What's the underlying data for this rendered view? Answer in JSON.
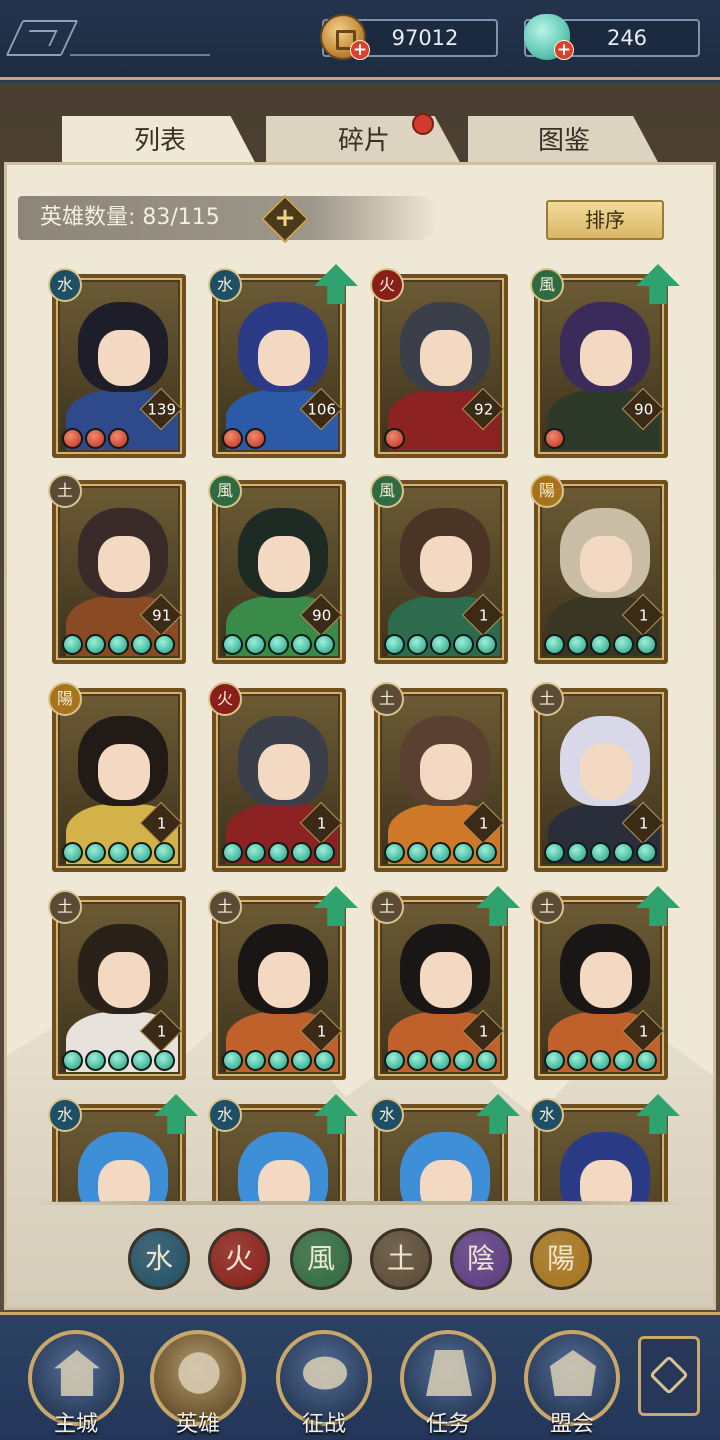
{
  "currency": {
    "coins": "97012",
    "jade": "246"
  },
  "tabs": [
    {
      "label": "列表",
      "active": true
    },
    {
      "label": "碎片",
      "active": false,
      "notification": true
    },
    {
      "label": "图鉴",
      "active": false
    }
  ],
  "hero_count_label": "英雄数量: 83/115",
  "sort_label": "排序",
  "heroes": [
    {
      "element": "水",
      "level": "139",
      "orbs": 3,
      "orb_color": "red",
      "upgrade": false,
      "hair": "#1e1e2a",
      "outfit": "#2e4a8a"
    },
    {
      "element": "水",
      "level": "106",
      "orbs": 2,
      "orb_color": "red",
      "upgrade": true,
      "hair": "#2b3b86",
      "outfit": "#2d5aa6"
    },
    {
      "element": "火",
      "level": "92",
      "orbs": 1,
      "orb_color": "red",
      "upgrade": false,
      "hair": "#3a3f4a",
      "outfit": "#8c2222"
    },
    {
      "element": "風",
      "level": "90",
      "orbs": 1,
      "orb_color": "red",
      "upgrade": true,
      "hair": "#3a2b5a",
      "outfit": "#2d3a2a"
    },
    {
      "element": "土",
      "level": "91",
      "orbs": 5,
      "orb_color": "green",
      "upgrade": false,
      "hair": "#3a2a2a",
      "outfit": "#8a4a24"
    },
    {
      "element": "風",
      "level": "90",
      "orbs": 5,
      "orb_color": "green",
      "upgrade": false,
      "hair": "#1e2a24",
      "outfit": "#3a8a4a"
    },
    {
      "element": "風",
      "level": "1",
      "orbs": 5,
      "orb_color": "green",
      "upgrade": false,
      "hair": "#4a3426",
      "outfit": "#2e6a4e"
    },
    {
      "element": "陽",
      "level": "1",
      "orbs": 5,
      "orb_color": "green",
      "upgrade": false,
      "hair": "#c9bda5",
      "outfit": "#3a3624"
    },
    {
      "element": "陽",
      "level": "1",
      "orbs": 5,
      "orb_color": "green",
      "upgrade": false,
      "hair": "#221a16",
      "outfit": "#d4b24a"
    },
    {
      "element": "火",
      "level": "1",
      "orbs": 5,
      "orb_color": "green",
      "upgrade": false,
      "hair": "#3a3f4a",
      "outfit": "#8c2222"
    },
    {
      "element": "土",
      "level": "1",
      "orbs": 5,
      "orb_color": "green",
      "upgrade": false,
      "hair": "#5a4030",
      "outfit": "#d0782a"
    },
    {
      "element": "土",
      "level": "1",
      "orbs": 5,
      "orb_color": "green",
      "upgrade": false,
      "hair": "#d8d8e8",
      "outfit": "#2a2e3a"
    },
    {
      "element": "土",
      "level": "1",
      "orbs": 5,
      "orb_color": "green",
      "upgrade": false,
      "hair": "#2a2218",
      "outfit": "#e8e2dc"
    },
    {
      "element": "土",
      "level": "1",
      "orbs": 5,
      "orb_color": "green",
      "upgrade": true,
      "hair": "#1a1616",
      "outfit": "#c0602a"
    },
    {
      "element": "土",
      "level": "1",
      "orbs": 5,
      "orb_color": "green",
      "upgrade": true,
      "hair": "#1a1616",
      "outfit": "#c0602a"
    },
    {
      "element": "土",
      "level": "1",
      "orbs": 5,
      "orb_color": "green",
      "upgrade": true,
      "hair": "#1a1616",
      "outfit": "#c0602a"
    },
    {
      "element": "水",
      "level": "",
      "orbs": 0,
      "orb_color": "green",
      "upgrade": true,
      "hair": "#3f8ed8",
      "outfit": "#2a5aa0"
    },
    {
      "element": "水",
      "level": "",
      "orbs": 0,
      "orb_color": "green",
      "upgrade": true,
      "hair": "#3f8ed8",
      "outfit": "#2a5aa0"
    },
    {
      "element": "水",
      "level": "",
      "orbs": 0,
      "orb_color": "green",
      "upgrade": true,
      "hair": "#3f8ed8",
      "outfit": "#2a5aa0"
    },
    {
      "element": "水",
      "level": "",
      "orbs": 0,
      "orb_color": "green",
      "upgrade": true,
      "hair": "#2b3b86",
      "outfit": "#2d5aa6"
    }
  ],
  "element_colors": {
    "水": "#1f4f66",
    "火": "#8a1f1a",
    "風": "#2f6a40",
    "土": "#5a4a36",
    "陰": "#5c3a84",
    "陽": "#a6741c"
  },
  "element_filters": [
    "水",
    "火",
    "風",
    "土",
    "陰",
    "陽"
  ],
  "nav": [
    {
      "label": "主城",
      "icon": "city-gate-icon",
      "active": false
    },
    {
      "label": "英雄",
      "icon": "hero-portrait-icon",
      "active": true
    },
    {
      "label": "征战",
      "icon": "war-drum-icon",
      "active": false
    },
    {
      "label": "任务",
      "icon": "scroll-quest-icon",
      "active": false
    },
    {
      "label": "盟会",
      "icon": "alliance-pavilion-icon",
      "active": false
    }
  ]
}
